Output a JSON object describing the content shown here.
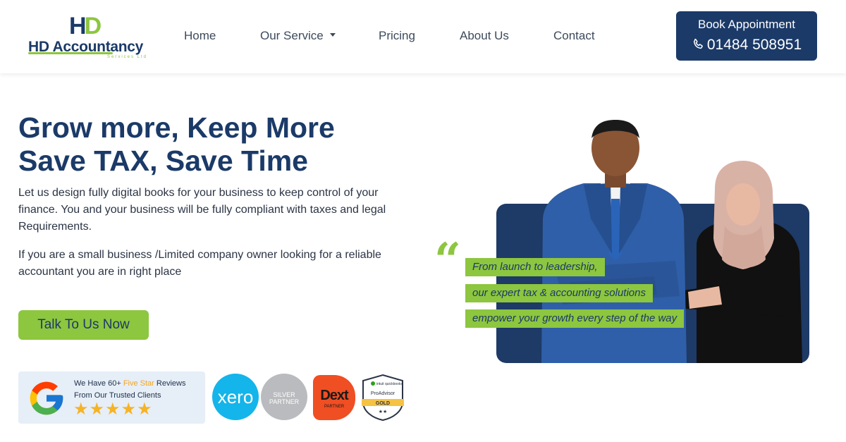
{
  "logo": {
    "monogram_h": "H",
    "monogram_d": "D",
    "name": "HD Accountancy",
    "tagline": "Services Ltd"
  },
  "nav": {
    "items": [
      {
        "label": "Home"
      },
      {
        "label": "Our Service"
      },
      {
        "label": "Pricing"
      },
      {
        "label": "About Us"
      },
      {
        "label": "Contact"
      }
    ]
  },
  "book": {
    "label": "Book Appointment",
    "phone": "01484 508951"
  },
  "hero": {
    "headline_line1": "Grow more, Keep More",
    "headline_line2": "Save TAX, Save Time",
    "para1": "Let us design fully digital books for your business to keep control of your finance. You and your business will be fully compliant with taxes and legal Requirements.",
    "para2": "If you are a small business /Limited company owner looking for a reliable accountant you are in right place",
    "cta_label": "Talk To Us Now"
  },
  "reviews": {
    "line1_prefix": "We Have 60+ ",
    "line1_highlight": "Five Star",
    "line1_suffix": " Reviews",
    "line2": "From Our Trusted Clients",
    "stars": "★★★★★",
    "rating": 5
  },
  "partners": {
    "xero": "xero",
    "silver_line1": "SILVER",
    "silver_line2": "PARTNER",
    "dext_name": "Dext",
    "dext_sub": "PARTNER",
    "qb_brand": "intuit quickbooks",
    "qb_title": "ProAdvisor",
    "qb_level": "GOLD",
    "qb_stars": "★★"
  },
  "quote": {
    "mark": "“",
    "line1": "From launch to leadership,",
    "line2": "our expert tax & accounting solutions",
    "line3": "empower your growth every step of the way"
  },
  "colors": {
    "navy": "#1b3a68",
    "green": "#8dc63f",
    "xero_blue": "#13b5ea",
    "dext_orange": "#f04e23",
    "star_gold": "#f6b324"
  }
}
